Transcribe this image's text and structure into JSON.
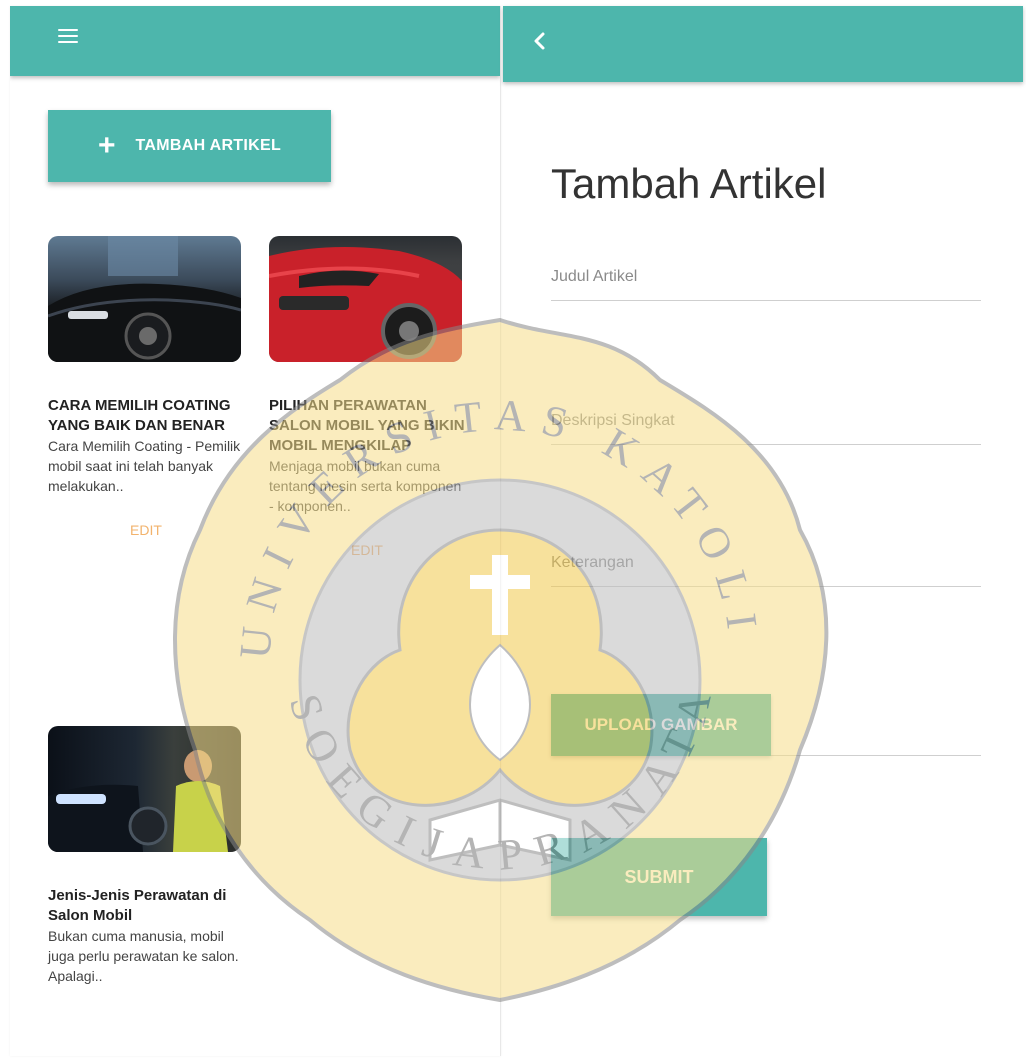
{
  "left": {
    "add_button_label": "TAMBAH ARTIKEL",
    "articles": [
      {
        "title": "CARA MEMILIH COATING YANG BAIK DAN BENAR",
        "description": "Cara Memilih Coating - Pemilik mobil saat ini telah banyak melakukan..",
        "edit_label": "EDIT"
      },
      {
        "title": "PILIHAN PERAWATAN SALON MOBIL YANG BIKIN MOBIL MENGKILAP",
        "description": "Menjaga mobil bukan cuma tentang mesin serta komponen - komponen..",
        "edit_label": "EDIT"
      },
      {
        "title": "Jenis-Jenis Perawatan di Salon Mobil",
        "description": "Bukan cuma manusia, mobil juga perlu perawatan ke salon. Apalagi.."
      }
    ]
  },
  "right": {
    "page_title": "Tambah Artikel",
    "fields": {
      "judul_placeholder": "Judul Artikel",
      "deskripsi_placeholder": "Deskripsi Singkat",
      "keterangan_placeholder": "Keterangan"
    },
    "upload_label": "UPLOAD GAMBAR",
    "submit_label": "SUBMIT"
  },
  "watermark": {
    "text_top": "UNIVERSITAS KATOLIK",
    "text_bottom": "SOEGIJAPRANATA"
  },
  "colors": {
    "primary": "#4db6ac",
    "edit": "#f2b36d",
    "watermark_gold": "#f2c94c"
  },
  "icons": {
    "menu": "menu-icon",
    "back": "chevron-left-icon",
    "add": "plus-icon"
  }
}
